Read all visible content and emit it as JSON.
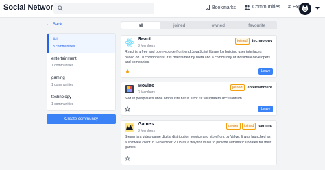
{
  "navbar": {
    "brand": "Social Network",
    "search_placeholder": "",
    "items": [
      {
        "label": "Bookmarks",
        "icon": "bookmark-icon"
      },
      {
        "label": "Communities",
        "icon": "communities-icon"
      },
      {
        "label": "Explore",
        "icon": "hashtag-icon"
      }
    ],
    "avatar_icon": "cat-avatar"
  },
  "sidebar": {
    "back_label": "Back",
    "items": [
      {
        "name": "All",
        "count": "3 communities",
        "active": true
      },
      {
        "name": "entertainment",
        "count": "1 communities"
      },
      {
        "name": "gaming",
        "count": "1 communities"
      },
      {
        "name": "technology",
        "count": "1 communities"
      }
    ],
    "create_label": "Create community"
  },
  "tabs": [
    {
      "label": "all",
      "active": true
    },
    {
      "label": "joined"
    },
    {
      "label": "owned"
    },
    {
      "label": "favourite"
    }
  ],
  "communities": [
    {
      "title": "React",
      "members": "3 Members",
      "badges": [
        "joined"
      ],
      "category": "technology",
      "description": "React is a free and open-source front-end JavaScript library for building user interfaces based on UI components. It is maintained by Meta and a community of individual developers and companies.",
      "favourite": true,
      "action": "Leave"
    },
    {
      "title": "Movies",
      "members": "3 Members",
      "badges": [
        "joined"
      ],
      "category": "entertainment",
      "description": "Sed ut perspiciatis unde omnis iste natus error sit voluptatem accusantium",
      "favourite": false,
      "action": "Leave"
    },
    {
      "title": "Games",
      "members": "3 Members",
      "badges": [
        "owner",
        "joined"
      ],
      "category": "gaming",
      "description": "Steam is a video game digital distribution service and storefront by Valve. It was launched as a software client in September 2003 as a way for Valve to provide automatic updates for their games",
      "favourite": false,
      "action": ""
    }
  ],
  "colors": {
    "accent": "#3b82f6",
    "badge": "#f59e0b",
    "star": "#f59e0b"
  }
}
